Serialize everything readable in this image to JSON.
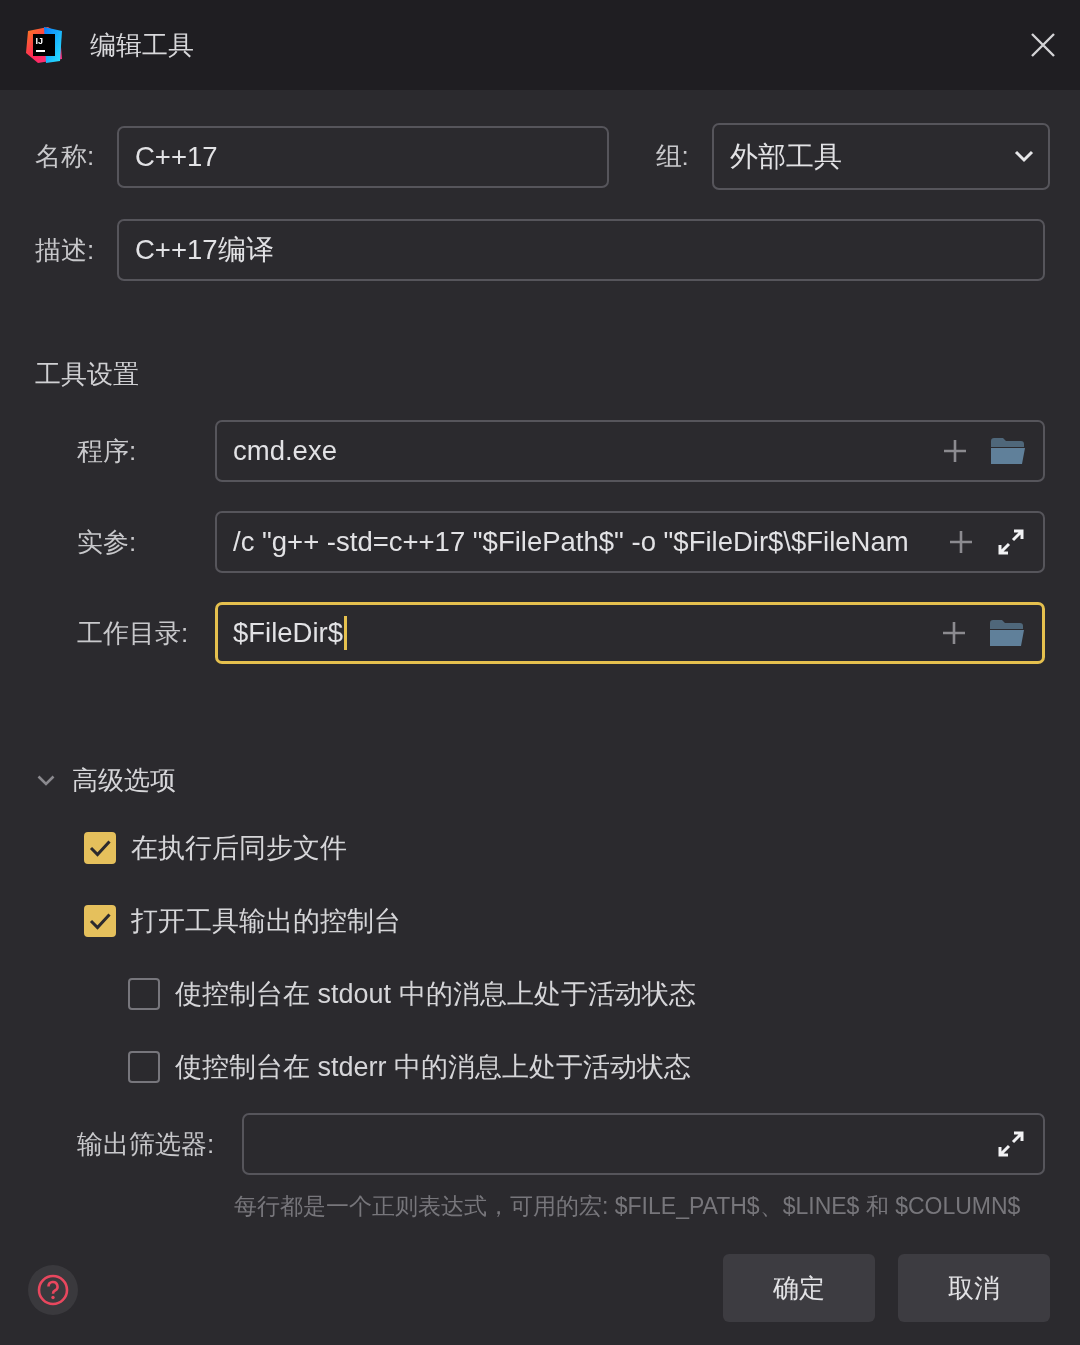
{
  "window": {
    "title": "编辑工具",
    "logo_text": "IJ"
  },
  "general": {
    "name": {
      "label": "名称:",
      "value": "C++17"
    },
    "group": {
      "label": "组:",
      "value": "外部工具"
    },
    "description": {
      "label": "描述:",
      "value": "C++17编译"
    }
  },
  "tool_settings": {
    "title": "工具设置",
    "fields": [
      {
        "label": "程序:",
        "value": "cmd.exe",
        "kind": "browse",
        "focused": false
      },
      {
        "label": "实参:",
        "value": "/c \"g++ -std=c++17 \"$FilePath$\" -o \"$FileDir$\\$FileNam",
        "kind": "expand",
        "focused": false
      },
      {
        "label": "工作目录:",
        "value": "$FileDir$",
        "kind": "browse",
        "focused": true
      }
    ]
  },
  "advanced": {
    "title": "高级选项",
    "expanded": true,
    "options": [
      {
        "label": "在执行后同步文件",
        "checked": true
      },
      {
        "label": "打开工具输出的控制台",
        "checked": true,
        "children": [
          {
            "label": "使控制台在 stdout 中的消息上处于活动状态",
            "checked": false
          },
          {
            "label": "使控制台在 stderr 中的消息上处于活动状态",
            "checked": false
          }
        ]
      }
    ],
    "output_filter": {
      "label": "输出筛选器:",
      "hint": "每行都是一个正则表达式，可用的宏: $FILE_PATH$、$LINE$ 和 $COLUMN$"
    }
  },
  "buttons": [
    "确定",
    "取消"
  ]
}
